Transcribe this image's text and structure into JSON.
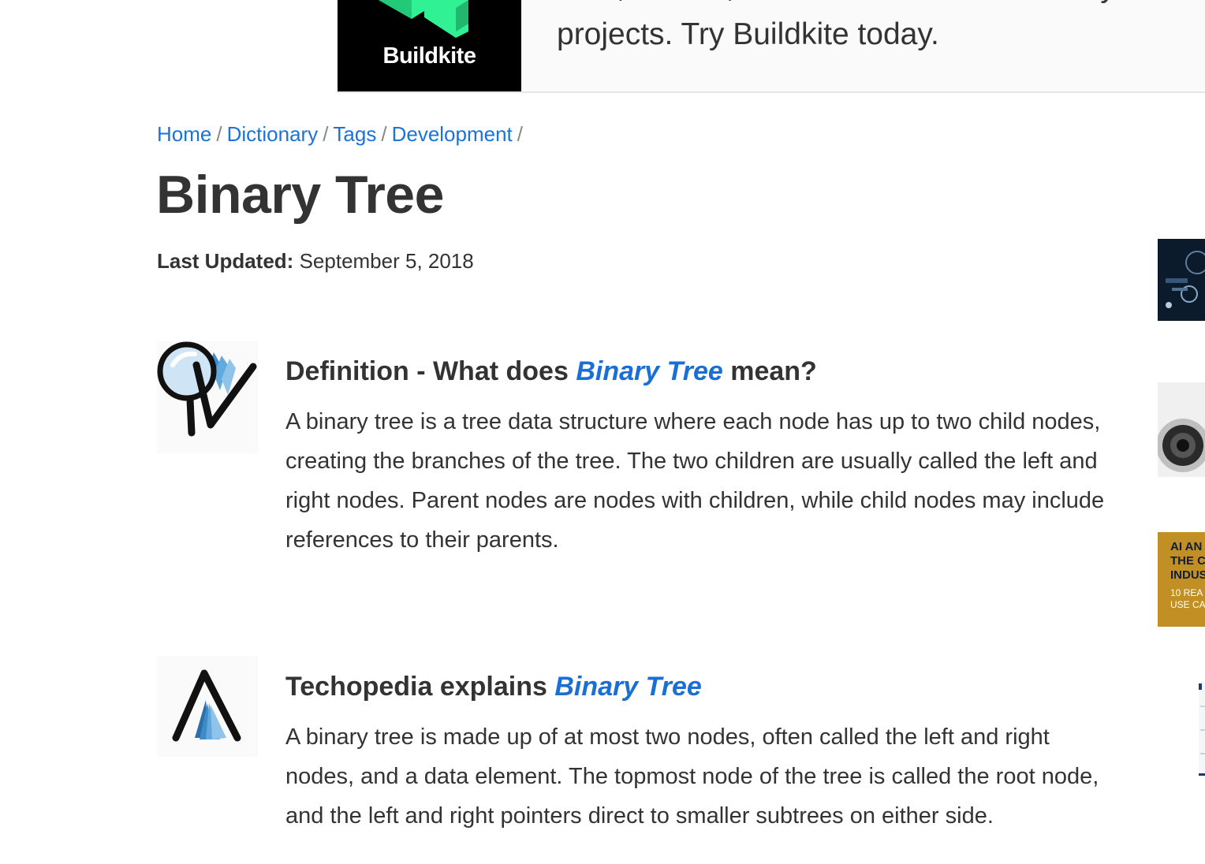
{
  "ad": {
    "logo_text": "Buildkite",
    "line1": "Fast, secure, and scalable CI/CD for all your",
    "line2": "projects. Try Buildkite today."
  },
  "breadcrumb": {
    "items": [
      "Home",
      "Dictionary",
      "Tags",
      "Development"
    ],
    "separator": "/"
  },
  "page": {
    "title": "Binary Tree",
    "last_updated_label": "Last Updated:",
    "last_updated_value": "September 5, 2018"
  },
  "definition": {
    "heading_prefix": "Definition - What does",
    "heading_term": "Binary Tree",
    "heading_suffix": "mean?",
    "body": "A binary tree is a tree data structure where each node has up to two child nodes, creating the branches of the tree. The two children are usually called the left and right nodes. Parent nodes are nodes with children, while child nodes may include references to their parents."
  },
  "explains": {
    "heading_prefix": "Techopedia explains",
    "heading_term": "Binary Tree",
    "body": "A binary tree is made up of at most two nodes, often called the left and right nodes, and a data element. The topmost node of the tree is called the root node, and the left and right pointers direct to smaller subtrees on either side."
  },
  "sidebar_thumbs": {
    "thumb3_title": [
      "AI AN",
      "THE C",
      "INDUS"
    ],
    "thumb3_sub": [
      "10 REA",
      "USE CA"
    ]
  },
  "colors": {
    "link": "#1a73d9",
    "accent_green": "#2ee68a",
    "text": "#333333"
  }
}
